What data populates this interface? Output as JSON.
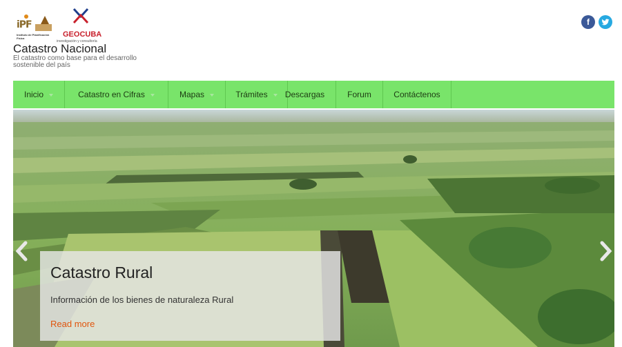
{
  "brand": {
    "ipf_logo_text": "iPF",
    "ipf_subtitle": "Instituto de Planificación Física",
    "geocuba_name": "GEOCUBA",
    "geocuba_subtitle": "investigación y consultoría",
    "site_title": "Catastro Nacional",
    "tagline": "El catastro como base para el desarrollo sostenible del país"
  },
  "social": {
    "facebook_glyph": "f",
    "twitter_glyph": "t"
  },
  "nav": {
    "items": [
      {
        "label": "Inicio",
        "has_dropdown": true
      },
      {
        "label": "Catastro en Cifras",
        "has_dropdown": true
      },
      {
        "label": "Mapas",
        "has_dropdown": true
      },
      {
        "label": "Trámites",
        "has_dropdown": true
      },
      {
        "label": "Descargas",
        "has_dropdown": false
      },
      {
        "label": "Forum",
        "has_dropdown": false
      },
      {
        "label": "Contáctenos",
        "has_dropdown": false
      }
    ]
  },
  "slider": {
    "caption_title": "Catastro Rural",
    "caption_text": "Información de los bienes de naturaleza Rural",
    "read_more": "Read more"
  },
  "colors": {
    "nav_bg": "#79e46a",
    "link_orange": "#e0550d",
    "facebook": "#3b5998",
    "twitter": "#27a9e1",
    "geocuba_red": "#c8202c"
  }
}
